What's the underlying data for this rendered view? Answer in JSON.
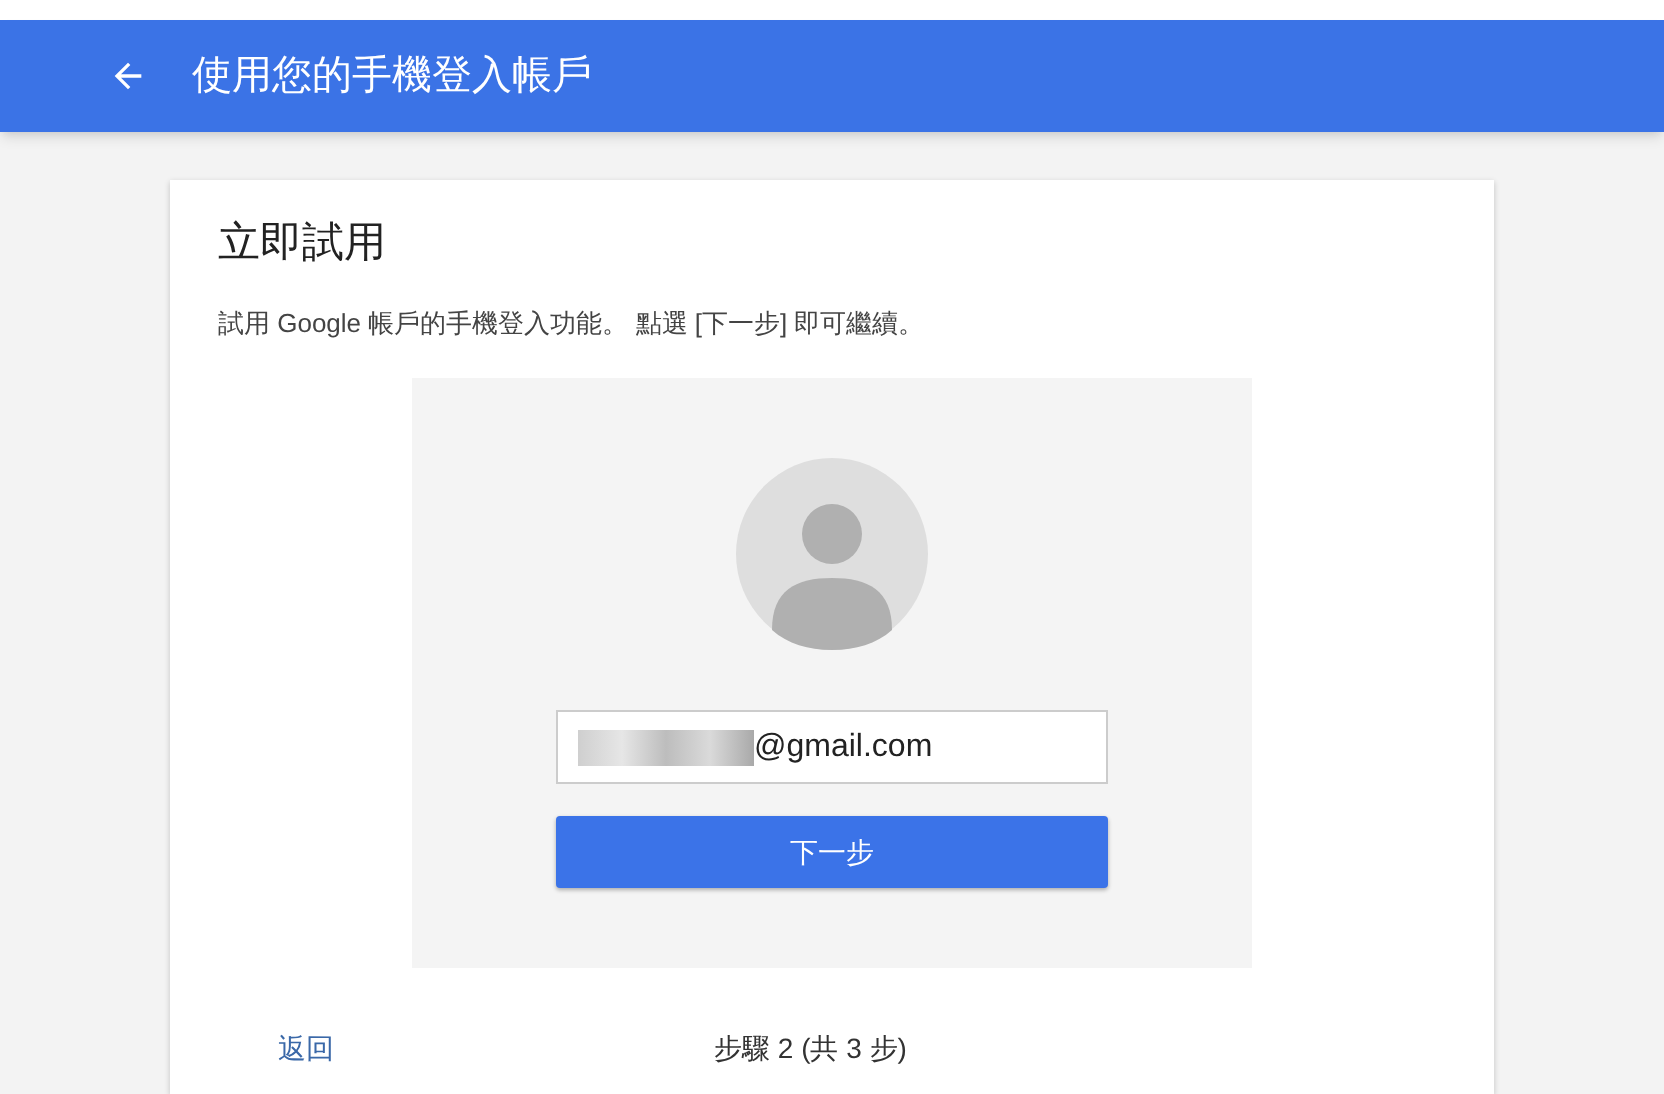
{
  "header": {
    "title": "使用您的手機登入帳戶"
  },
  "card": {
    "title": "立即試用",
    "description": "試用 Google 帳戶的手機登入功能。 點選 [下一步] 即可繼續。"
  },
  "email_field": {
    "value": "@gmail.com"
  },
  "next_button": {
    "label": "下一步"
  },
  "footer": {
    "back_link": "返回",
    "step": "步驟 2 (共 3 步)"
  }
}
